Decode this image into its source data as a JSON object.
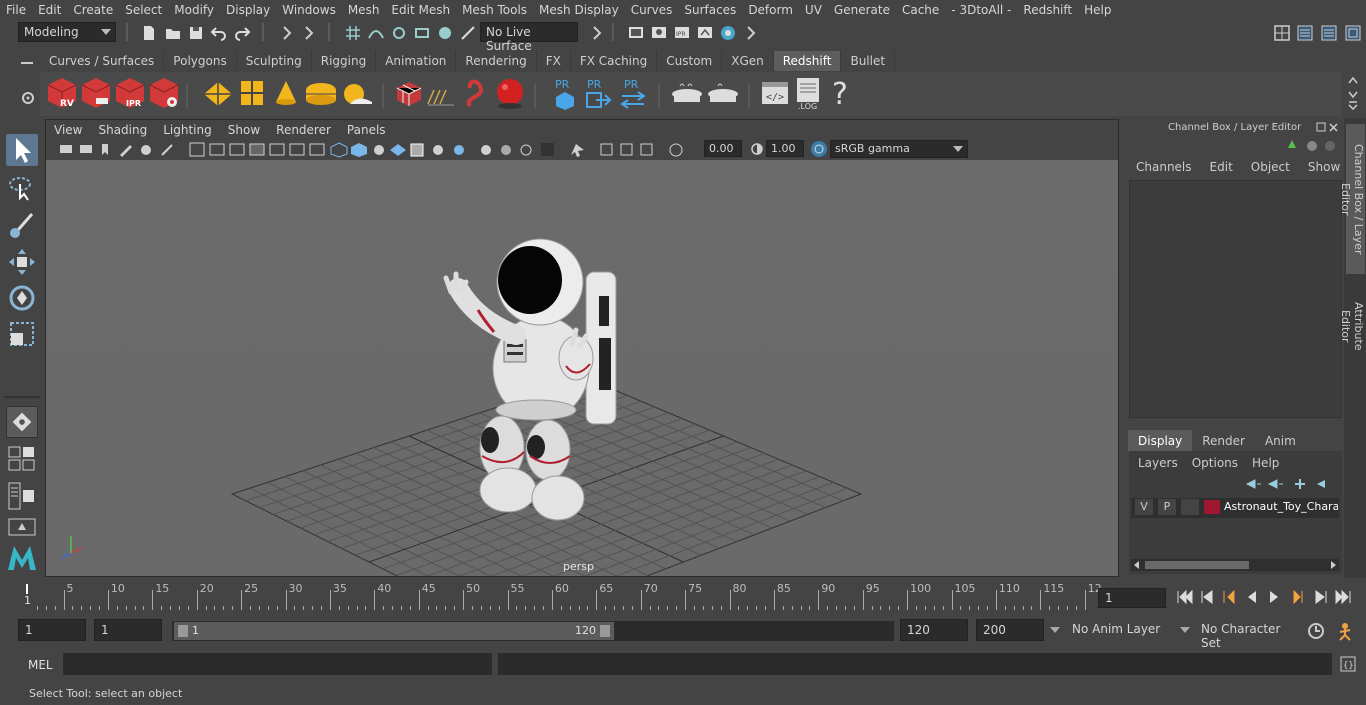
{
  "menu": [
    "File",
    "Edit",
    "Create",
    "Select",
    "Modify",
    "Display",
    "Windows",
    "Mesh",
    "Edit Mesh",
    "Mesh Tools",
    "Mesh Display",
    "Curves",
    "Surfaces",
    "Deform",
    "UV",
    "Generate",
    "Cache",
    "- 3DtoAll -",
    "Redshift",
    "Help"
  ],
  "status": {
    "workspace": "Modeling",
    "live_surface": "No Live Surface"
  },
  "shelf_tabs": [
    "Curves / Surfaces",
    "Polygons",
    "Sculpting",
    "Rigging",
    "Animation",
    "Rendering",
    "FX",
    "FX Caching",
    "Custom",
    "XGen",
    "Redshift",
    "Bullet"
  ],
  "shelf_active": "Redshift",
  "shelf_icons": {
    "rv": "RV",
    "ipr": "IPR",
    "pr": "PR",
    "log": ".LOG",
    "help": "?"
  },
  "viewport": {
    "menu": [
      "View",
      "Shading",
      "Lighting",
      "Show",
      "Renderer",
      "Panels"
    ],
    "exposure": "0.00",
    "gamma": "1.00",
    "colorspace": "sRGB gamma",
    "camera": "persp"
  },
  "channel_box": {
    "title": "Channel Box / Layer Editor",
    "menu": [
      "Channels",
      "Edit",
      "Object",
      "Show"
    ],
    "layer_tabs": [
      "Display",
      "Render",
      "Anim"
    ],
    "layer_menu": [
      "Layers",
      "Options",
      "Help"
    ],
    "layer": {
      "v": "V",
      "p": "P",
      "name": "Astronaut_Toy_Charac",
      "color": "#a01830"
    }
  },
  "side_tabs": [
    "Channel Box / Layer Editor",
    "Attribute Editor"
  ],
  "timeline": {
    "ticks": [
      "5",
      "10",
      "15",
      "20",
      "25",
      "30",
      "35",
      "40",
      "45",
      "50",
      "55",
      "60",
      "65",
      "70",
      "75",
      "80",
      "85",
      "90",
      "95",
      "100",
      "105",
      "110",
      "115",
      "12"
    ],
    "start_label": "1",
    "current_frame": "1"
  },
  "range": {
    "start": "1",
    "playback_start": "1",
    "slider_start": "1",
    "slider_end": "120",
    "playback_end": "120",
    "end": "200",
    "anim_layer": "No Anim Layer",
    "char_set": "No Character Set"
  },
  "command": {
    "lang": "MEL"
  },
  "help": "Select Tool: select an object"
}
